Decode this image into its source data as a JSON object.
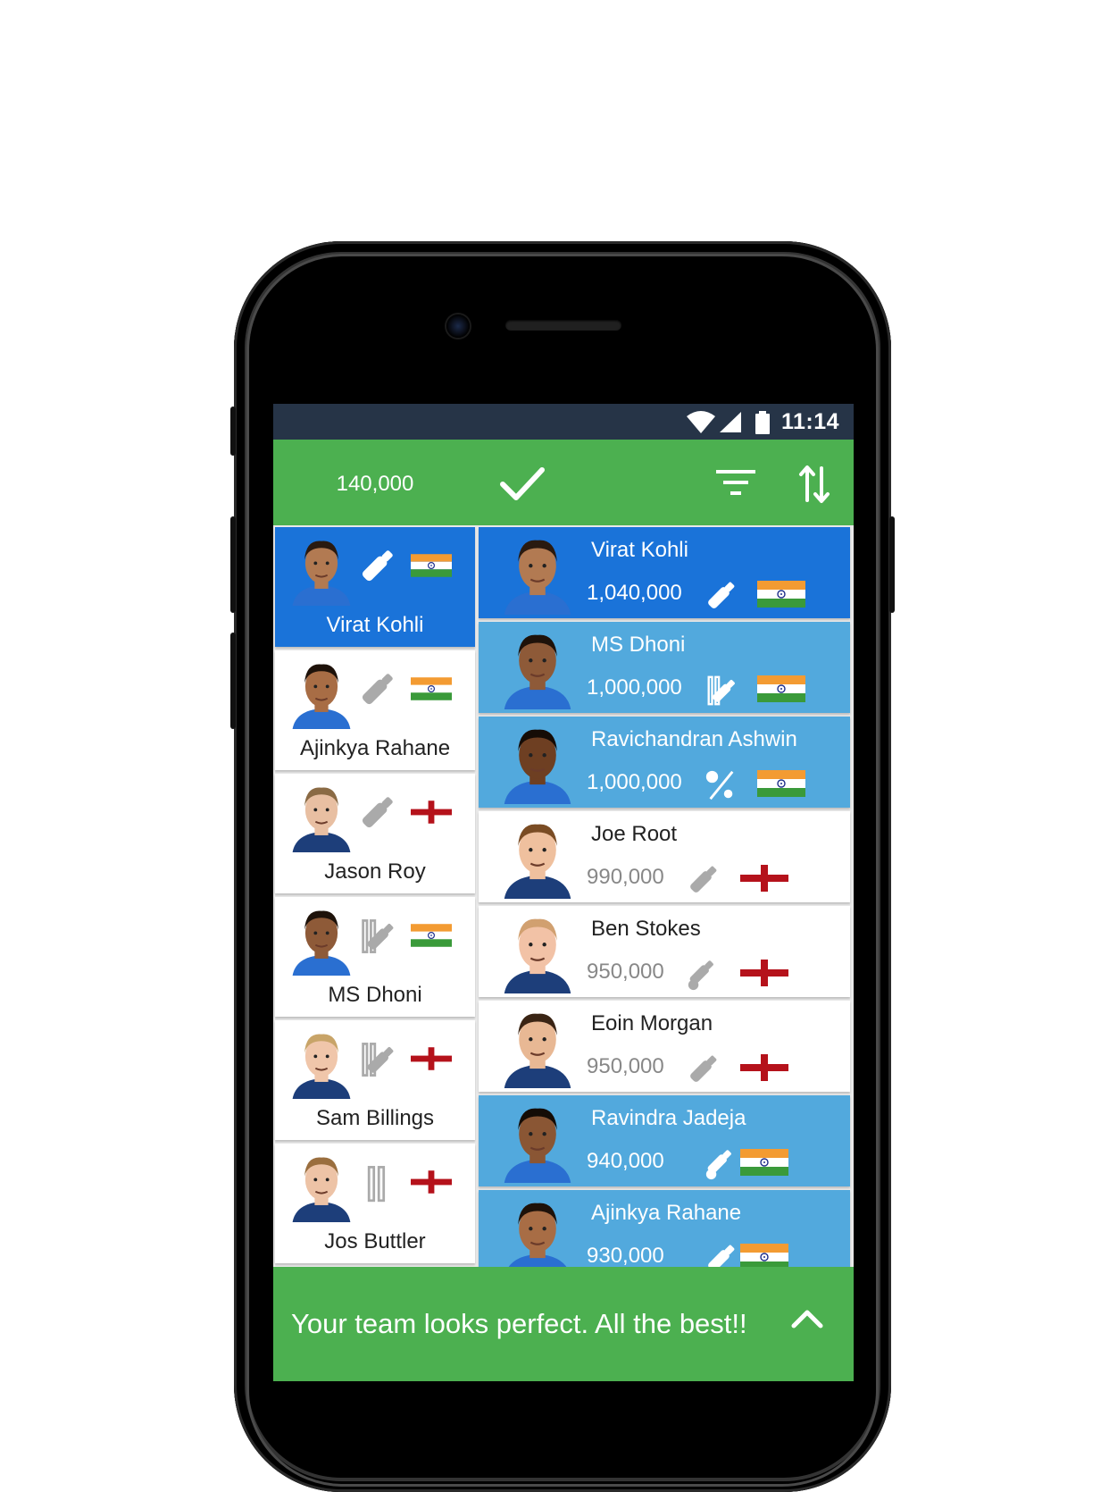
{
  "status_bar": {
    "time": "11:14",
    "icons": [
      "wifi-icon",
      "signal-icon",
      "battery-icon"
    ]
  },
  "app_bar": {
    "budget": "140,000",
    "confirm_icon": "check-icon",
    "filter_icon": "filter-icon",
    "sort_icon": "sort-icon"
  },
  "colors": {
    "accent_green": "#4cb050",
    "selected_blue": "#1a73d9",
    "picked_blue": "#52a9dd",
    "status_bar": "#263447"
  },
  "selected_team": [
    {
      "name": "Virat Kohli",
      "role": "bat-icon",
      "country": "india-flag",
      "selected": true
    },
    {
      "name": "Ajinkya Rahane",
      "role": "bat-icon",
      "country": "india-flag",
      "selected": false
    },
    {
      "name": "Jason Roy",
      "role": "bat-icon",
      "country": "england-flag",
      "selected": false
    },
    {
      "name": "MS Dhoni",
      "role": "wicketkeeper-bat-icon",
      "country": "india-flag",
      "selected": false
    },
    {
      "name": "Sam Billings",
      "role": "wicketkeeper-bat-icon",
      "country": "england-flag",
      "selected": false
    },
    {
      "name": "Jos Buttler",
      "role": "wicket-icon",
      "country": "england-flag",
      "selected": false
    }
  ],
  "players": [
    {
      "name": "Virat Kohli",
      "price": "1,040,000",
      "role": "bat-icon",
      "country": "india-flag",
      "state": "selected"
    },
    {
      "name": "MS Dhoni",
      "price": "1,000,000",
      "role": "wicketkeeper-bat-icon",
      "country": "india-flag",
      "state": "picked"
    },
    {
      "name": "Ravichandran Ashwin",
      "price": "1,000,000",
      "role": "bowler-icon",
      "country": "india-flag",
      "state": "picked"
    },
    {
      "name": "Joe Root",
      "price": "990,000",
      "role": "bat-icon",
      "country": "england-flag",
      "state": "none"
    },
    {
      "name": "Ben Stokes",
      "price": "950,000",
      "role": "allrounder-icon",
      "country": "england-flag",
      "state": "none"
    },
    {
      "name": "Eoin Morgan",
      "price": "950,000",
      "role": "bat-icon",
      "country": "england-flag",
      "state": "none"
    },
    {
      "name": "Ravindra Jadeja",
      "price": "940,000",
      "role": "allrounder-icon",
      "country": "india-flag",
      "state": "picked"
    },
    {
      "name": "Ajinkya Rahane",
      "price": "930,000",
      "role": "bat-icon",
      "country": "india-flag",
      "state": "picked"
    }
  ],
  "bottom_bar": {
    "message": "Your team looks perfect. All the best!!",
    "expand_icon": "chevron-up-icon"
  }
}
